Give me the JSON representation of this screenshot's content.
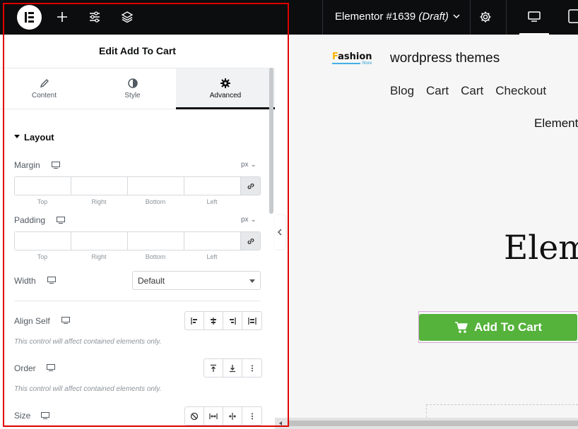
{
  "topbar": {
    "document_title": "Elementor #1639",
    "document_status": "(Draft)",
    "icons": [
      "elementor-logo-icon",
      "plus-icon",
      "sliders-icon",
      "layers-icon",
      "chevron-down-icon",
      "settings-gear-icon",
      "desktop-icon",
      "tablet-icon"
    ]
  },
  "panel": {
    "title": "Edit Add To Cart",
    "tabs": [
      {
        "label": "Content",
        "icon": "pencil-icon"
      },
      {
        "label": "Style",
        "icon": "half-circle-icon"
      },
      {
        "label": "Advanced",
        "icon": "gear-icon",
        "active": true
      }
    ],
    "section": "Layout",
    "margin": {
      "label": "Margin",
      "unit": "px",
      "sides": [
        "Top",
        "Right",
        "Bottom",
        "Left"
      ],
      "values": [
        "",
        "",
        "",
        ""
      ]
    },
    "padding": {
      "label": "Padding",
      "unit": "px",
      "sides": [
        "Top",
        "Right",
        "Bottom",
        "Left"
      ],
      "values": [
        "",
        "",
        "",
        ""
      ]
    },
    "width": {
      "label": "Width",
      "value": "Default"
    },
    "align_self": {
      "label": "Align Self",
      "note": "This control will affect contained elements only."
    },
    "order": {
      "label": "Order",
      "note": "This control will affect contained elements only."
    },
    "size": {
      "label": "Size"
    }
  },
  "preview": {
    "logo_text": "Fashion",
    "logo_first_letter": "F",
    "logo_rest": "ashion",
    "logo_sub": "Store",
    "site_title": "wordpress themes",
    "nav": [
      "Blog",
      "Cart",
      "Cart",
      "Checkout"
    ],
    "sub_text": "Element",
    "heading": "Elem",
    "add_to_cart": "Add To Cart"
  },
  "colors": {
    "topbar": "#0c0d0e",
    "accent_red": "#e00000",
    "button_green": "#55b23b",
    "logo_yellow": "#f5b400"
  }
}
